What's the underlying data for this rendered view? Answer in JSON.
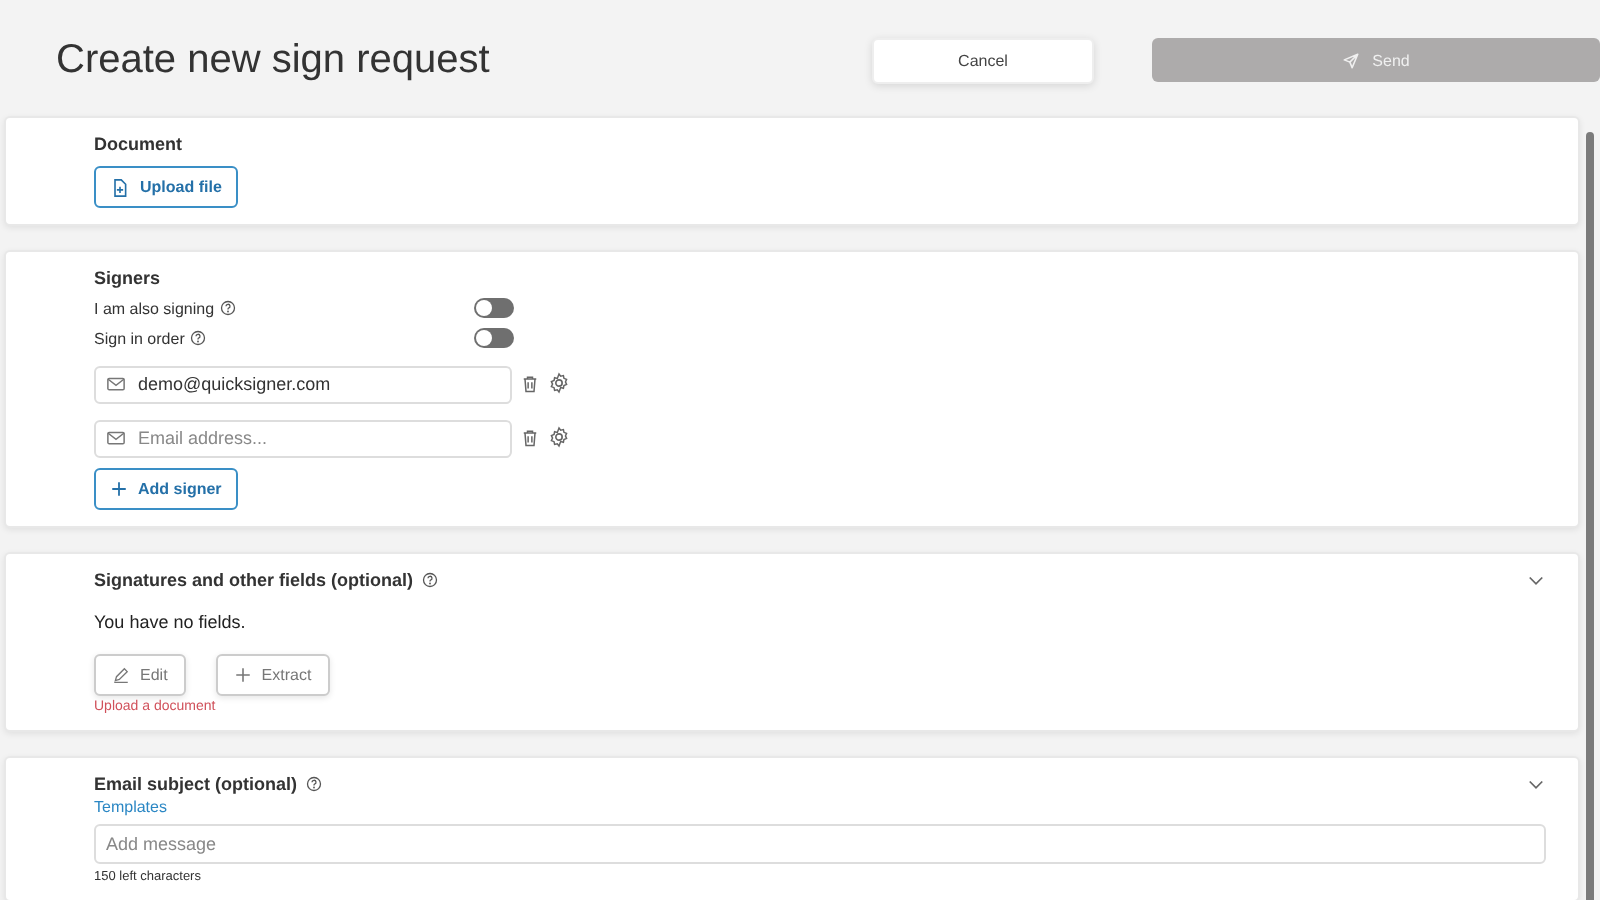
{
  "header": {
    "title": "Create new sign request",
    "cancel": "Cancel",
    "send": {
      "label": "Send",
      "disabled": true
    }
  },
  "document": {
    "title": "Document",
    "upload": "Upload file"
  },
  "signers": {
    "title": "Signers",
    "options": [
      {
        "label": "I am also signing",
        "on": false
      },
      {
        "label": "Sign in order",
        "on": false
      }
    ],
    "emails": [
      {
        "value": "demo@quicksigner.com"
      },
      {
        "placeholder": "Email address..."
      }
    ],
    "add": "Add signer"
  },
  "fields": {
    "title": "Signatures and other fields (optional)",
    "empty": "You have no fields.",
    "buttons": [
      {
        "kind": "edit",
        "label": "Edit"
      },
      {
        "kind": "extract",
        "label": "Extract"
      }
    ],
    "error": "Upload a document"
  },
  "subject": {
    "title": "Email subject (optional)",
    "templates": "Templates",
    "placeholder": "Add message",
    "counter": "150 left characters"
  }
}
